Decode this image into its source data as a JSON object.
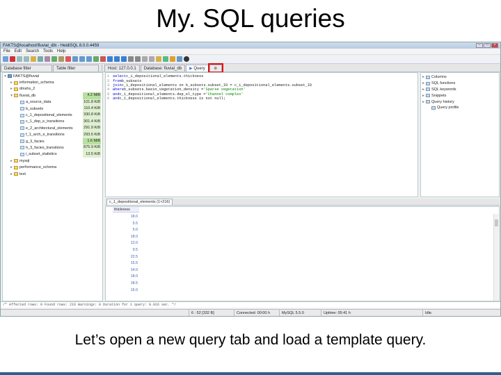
{
  "slide": {
    "title": "My. SQL queries",
    "caption": "Let’s open a new query tab and load a template query."
  },
  "window": {
    "title": "FAKTS@localhost\\fluvial_db\\ - HeidiSQL 8.0.0.4459",
    "menu": [
      "File",
      "Edit",
      "Search",
      "Tools",
      "Help"
    ]
  },
  "tabs": {
    "database_filter": "Database filter",
    "table_filter": "Table filter",
    "host": "Host: 127.0.0.1",
    "database": "Database: fluvial_db",
    "query": "Query"
  },
  "tree": [
    {
      "label": "FAKTS@fluvial",
      "expander": "▾",
      "kind": "host",
      "size": ""
    },
    {
      "label": "information_schema",
      "expander": "▸",
      "kind": "db",
      "size": ""
    },
    {
      "label": "dmshs_2",
      "expander": "▸",
      "kind": "db",
      "size": ""
    },
    {
      "label": "fluvial_db",
      "expander": "▾",
      "kind": "db",
      "size": "4.2 MiB"
    },
    {
      "label": "a_source_data",
      "expander": "",
      "kind": "tbl",
      "size": "101.8 KiB"
    },
    {
      "label": "b_subsets",
      "expander": "",
      "kind": "tbl",
      "size": "110.4 KiB"
    },
    {
      "label": "c_1_depositional_elements",
      "expander": "",
      "kind": "tbl",
      "size": "330.8 KiB"
    },
    {
      "label": "c_1_dep_e_transitions",
      "expander": "",
      "kind": "tbl",
      "size": "301.4 KiB"
    },
    {
      "label": "e_2_architectural_elements",
      "expander": "",
      "kind": "tbl",
      "size": "291.9 KiB"
    },
    {
      "label": "f_1_arch_e_transitions",
      "expander": "",
      "kind": "tbl",
      "size": "293.5 KiB"
    },
    {
      "label": "g_3_facies",
      "expander": "",
      "kind": "tbl",
      "size": "1.6 MiB"
    },
    {
      "label": "h_3_facies_transitions",
      "expander": "",
      "kind": "tbl",
      "size": "875.9 KiB"
    },
    {
      "label": "i_subset_statistics",
      "expander": "",
      "kind": "tbl",
      "size": "13.5 KiB"
    },
    {
      "label": "mysql",
      "expander": "▸",
      "kind": "db",
      "size": ""
    },
    {
      "label": "performance_schema",
      "expander": "▸",
      "kind": "db",
      "size": ""
    },
    {
      "label": "test",
      "expander": "▸",
      "kind": "db",
      "size": ""
    }
  ],
  "editor": {
    "lines": [
      {
        "n": "1",
        "kw": "select",
        "rest": " c_1_depositional_elements.thickness",
        "str": ""
      },
      {
        "n": "2",
        "kw": "from",
        "rest": " b_subsets",
        "str": ""
      },
      {
        "n": "3",
        "kw": "join",
        "rest": " c_1_depositional_elements on b_subsets.subset_ID = c_1_depositional_elements.subset_ID",
        "str": ""
      },
      {
        "n": "4",
        "kw": "where",
        "rest": " b_subsets.basin_vegetation_density = ",
        "str": "'Sparse vegetation'"
      },
      {
        "n": "5",
        "kw": "and",
        "rest": " c_1_depositional_elements.dep_el_type = ",
        "str": "'Channel complex'"
      },
      {
        "n": "6",
        "kw": "and",
        "rest": " c_1_depositional_elements.thickness is not null;",
        "str": ""
      }
    ]
  },
  "helpers": [
    "Columns",
    "SQL functions",
    "SQL keywords",
    "Snippets",
    "Query history",
    "Query profile"
  ],
  "result": {
    "tab_label": "c_1_depositional_elements (1×216)",
    "column": "thickness",
    "values": [
      "18.0",
      "5.5",
      "5.0",
      "18.0",
      "12.0",
      "9.5",
      "22.5",
      "15.5",
      "14.0",
      "18.0",
      "18.5",
      "15.0"
    ]
  },
  "log": "/* Affected rows: 0  Found rows: 216  Warnings: 0  Duration for 1 query: 0.016 sec. */",
  "status": {
    "position": "6 : 52 [332 B]",
    "connected": "Connected: 00:00 h",
    "server": "MySQL 5.5.0",
    "uptime": "Uptime: 05:41 h",
    "state": "Idle."
  }
}
